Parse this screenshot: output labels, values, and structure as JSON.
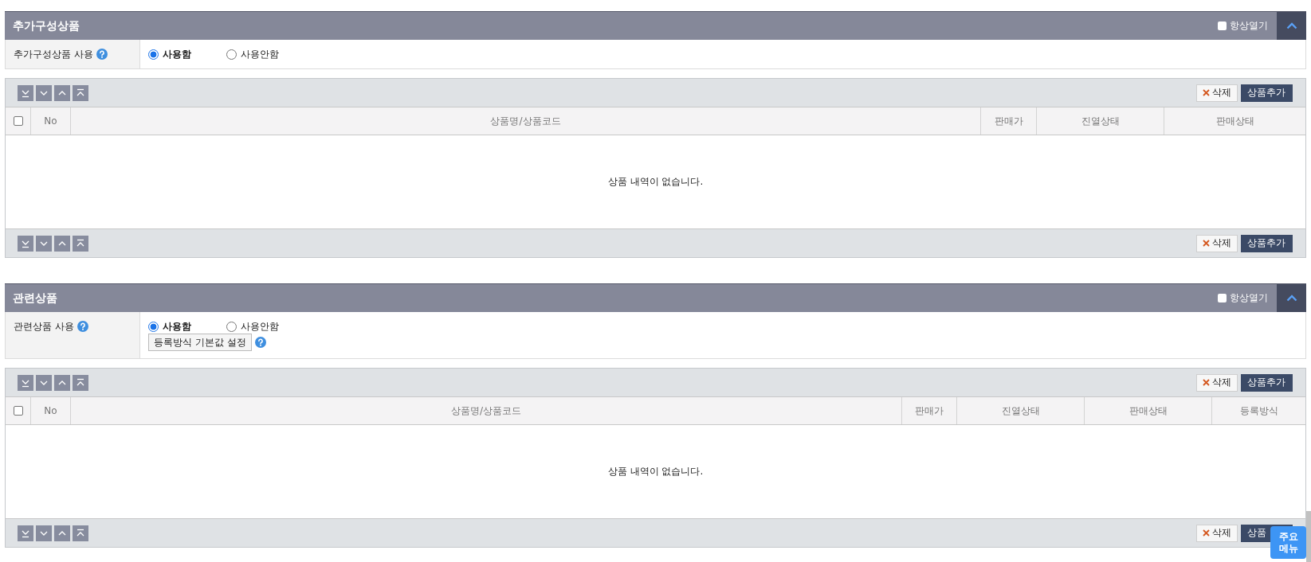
{
  "sections": [
    {
      "title": "추가구성상품",
      "expanded": true,
      "always_open": {
        "label": "항상열기",
        "checked": false
      },
      "option": {
        "label": "추가구성상품 사용",
        "radios": [
          {
            "label": "사용함",
            "selected": true
          },
          {
            "label": "사용안함",
            "selected": false
          }
        ]
      },
      "list": {
        "toolbar_top": {
          "buttons": [
            {
              "label": "삭제",
              "kind": "delete"
            },
            {
              "label": "상품추가",
              "kind": "add"
            }
          ]
        },
        "select_all_checked": false,
        "columns": [
          "No",
          "상품명/상품코드",
          "판매가",
          "진열상태",
          "판매상태"
        ],
        "empty_message": "상품 내역이 없습니다.",
        "toolbar_bottom": {
          "buttons": [
            {
              "label": "삭제",
              "kind": "delete"
            },
            {
              "label": "상품추가",
              "kind": "add"
            }
          ]
        }
      }
    },
    {
      "title": "관련상품",
      "expanded": true,
      "always_open": {
        "label": "항상열기",
        "checked": false
      },
      "option": {
        "label": "관련상품 사용",
        "radios": [
          {
            "label": "사용함",
            "selected": true
          },
          {
            "label": "사용안함",
            "selected": false
          }
        ],
        "setting_button": "등록방식 기본값 설정"
      },
      "list": {
        "toolbar_top": {
          "buttons": [
            {
              "label": "삭제",
              "kind": "delete"
            },
            {
              "label": "상품추가",
              "kind": "add"
            }
          ]
        },
        "select_all_checked": false,
        "columns": [
          "No",
          "상품명/상품코드",
          "판매가",
          "진열상태",
          "판매상태",
          "등록방식"
        ],
        "empty_message": "상품 내역이 없습니다.",
        "toolbar_bottom": {
          "buttons": [
            {
              "label": "삭제",
              "kind": "delete"
            },
            {
              "label": "상품",
              "kind": "add"
            }
          ]
        }
      }
    }
  ],
  "quick_menu": {
    "label": "주요 메뉴"
  }
}
